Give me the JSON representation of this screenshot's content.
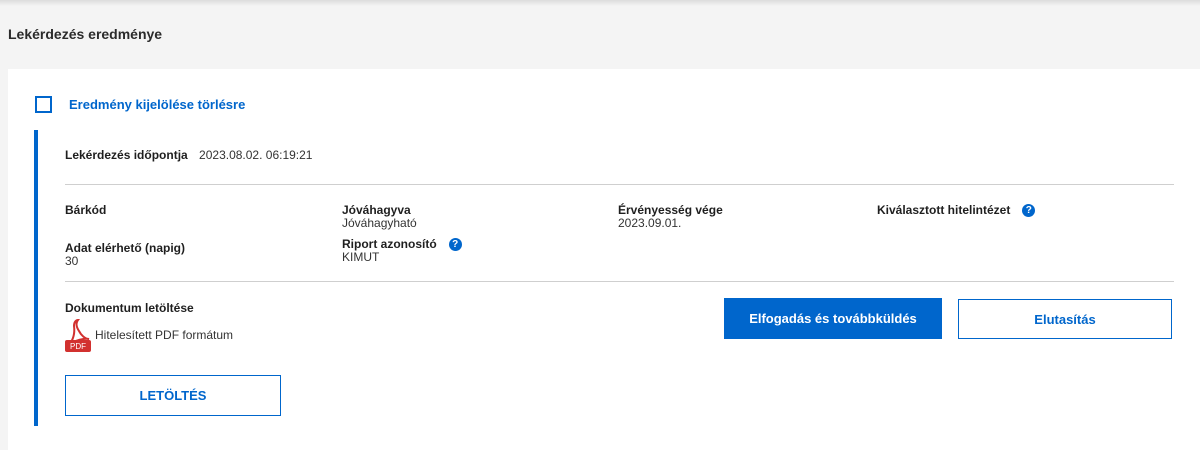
{
  "section_title": "Lekérdezés eredménye",
  "select_for_delete_label": "Eredmény kijelölése törlésre",
  "query_time": {
    "label": "Lekérdezés időpontja",
    "value": "2023.08.02. 06:19:21"
  },
  "fields": {
    "barcode": {
      "label": "Bárkód",
      "value": ""
    },
    "approved": {
      "label": "Jóváhagyva",
      "value": "Jóváhagyható"
    },
    "validity_end": {
      "label": "Érvényesség vége",
      "value": "2023.09.01."
    },
    "selected_institution": {
      "label": "Kiválasztott hitelintézet",
      "value": ""
    },
    "data_available_days": {
      "label": "Adat elérhető (napig)",
      "value": "30"
    },
    "report_id": {
      "label": "Riport azonosító",
      "value": "KIMUT"
    }
  },
  "help_icon_glyph": "?",
  "document": {
    "title": "Dokumentum letöltése",
    "format_label": "Hitelesített PDF formátum",
    "pdf_badge": "PDF"
  },
  "buttons": {
    "download": "LETÖLTÉS",
    "accept_forward": "Elfogadás és továbbküldés",
    "reject": "Elutasítás"
  },
  "colors": {
    "accent": "#0066cc",
    "page_bg": "#f4f4f4",
    "card_bg": "#ffffff",
    "pdf_red": "#d2312f"
  },
  "icons": {
    "help": "question-circle-icon",
    "pdf": "pdf-file-icon",
    "checkbox": "checkbox-unchecked"
  }
}
